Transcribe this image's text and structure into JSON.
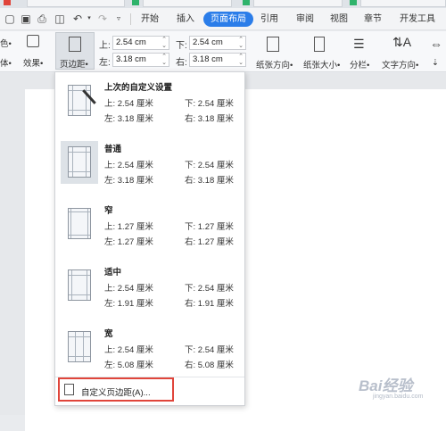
{
  "menubar": {
    "tabs": [
      {
        "label": "开始"
      },
      {
        "label": "插入"
      },
      {
        "label": "页面布局"
      },
      {
        "label": "引用"
      },
      {
        "label": "审阅"
      },
      {
        "label": "视图"
      },
      {
        "label": "章节"
      },
      {
        "label": "开发工具"
      }
    ],
    "active_tab": "页面布局"
  },
  "ribbon": {
    "color_partial": "色",
    "font_partial": "体",
    "effects_label": "效果",
    "margins_label": "页边距",
    "top_label": "上:",
    "top_value": "2.54 cm",
    "bottom_label": "下:",
    "bottom_value": "2.54 cm",
    "left_label": "左:",
    "left_value": "3.18 cm",
    "right_label": "右:",
    "right_value": "3.18 cm",
    "orientation_label": "纸张方向",
    "size_label": "纸张大小",
    "columns_label": "分栏",
    "text_direction_label": "文字方向"
  },
  "margin_presets": [
    {
      "name": "上次的自定义设置",
      "top": "上: 2.54 厘米",
      "bottom": "下: 2.54 厘米",
      "left": "左: 3.18 厘米",
      "right": "右: 3.18 厘米"
    },
    {
      "name": "普通",
      "top": "上: 2.54 厘米",
      "bottom": "下: 2.54 厘米",
      "left": "左: 3.18 厘米",
      "right": "右: 3.18 厘米"
    },
    {
      "name": "窄",
      "top": "上: 1.27 厘米",
      "bottom": "下: 1.27 厘米",
      "left": "左: 1.27 厘米",
      "right": "右: 1.27 厘米"
    },
    {
      "name": "适中",
      "top": "上: 2.54 厘米",
      "bottom": "下: 2.54 厘米",
      "left": "左: 1.91 厘米",
      "right": "右: 1.91 厘米"
    },
    {
      "name": "宽",
      "top": "上: 2.54 厘米",
      "bottom": "下: 2.54 厘米",
      "left": "左: 5.08 厘米",
      "right": "右: 5.08 厘米"
    }
  ],
  "custom_margins_label": "自定义页边距(A)...",
  "watermark": {
    "text": "Bai经验",
    "sub": "jingyan.baidu.com"
  },
  "colors": {
    "accent": "#2b7de9",
    "highlight_border": "#e0453b"
  }
}
